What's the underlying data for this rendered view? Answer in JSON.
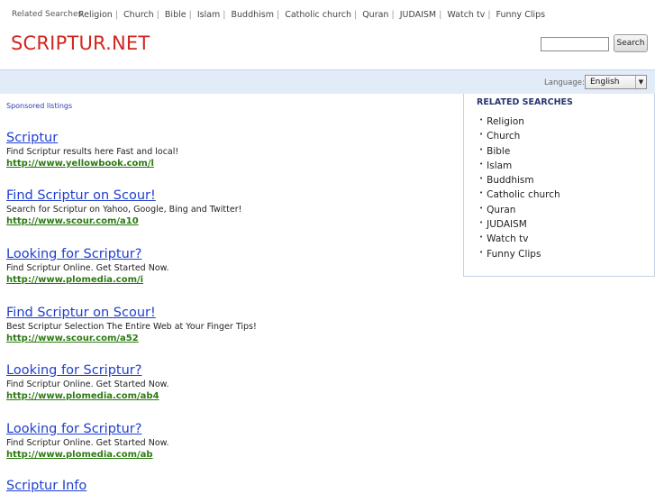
{
  "topbar": {
    "label": "Related Searches",
    "links": [
      "Religion",
      "Church",
      "Bible",
      "Islam",
      "Buddhism",
      "Catholic church",
      "Quran",
      "JUDAISM",
      "Watch tv",
      "Funny Clips"
    ]
  },
  "header": {
    "logo": "SCRIPTUR.NET",
    "search_value": "",
    "search_button": "Search"
  },
  "language": {
    "label": "Language:",
    "selected": "English"
  },
  "main": {
    "sponsored_label": "Sponsored listings",
    "listings": [
      {
        "title": "Scriptur",
        "desc": "Find Scriptur results here Fast and local!",
        "url": "http://www.yellowbook.com/l"
      },
      {
        "title": "Find Scriptur on Scour!",
        "desc": "Search for Scriptur on Yahoo, Google, Bing and Twitter!",
        "url": "http://www.scour.com/a10"
      },
      {
        "title": "Looking for Scriptur?",
        "desc": "Find Scriptur Online. Get Started Now.",
        "url": "http://www.plomedia.com/i"
      },
      {
        "title": "Find Scriptur on Scour!",
        "desc": "Best Scriptur Selection The Entire Web at Your Finger Tips!",
        "url": "http://www.scour.com/a52"
      },
      {
        "title": "Looking for Scriptur?",
        "desc": "Find Scriptur Online. Get Started Now.",
        "url": "http://www.plomedia.com/ab4"
      },
      {
        "title": "Looking for Scriptur?",
        "desc": "Find Scriptur Online. Get Started Now.",
        "url": "http://www.plomedia.com/ab"
      },
      {
        "title": "Scriptur Info",
        "desc": "",
        "url": ""
      }
    ]
  },
  "related": {
    "heading": "RELATED SEARCHES",
    "items": [
      "Religion",
      "Church",
      "Bible",
      "Islam",
      "Buddhism",
      "Catholic church",
      "Quran",
      "JUDAISM",
      "Watch tv",
      "Funny Clips"
    ]
  },
  "colors": {
    "logo": "#d2261f",
    "link": "#1f3fcf",
    "url": "#2d7a13",
    "language_bar": "#e2ebf8"
  }
}
